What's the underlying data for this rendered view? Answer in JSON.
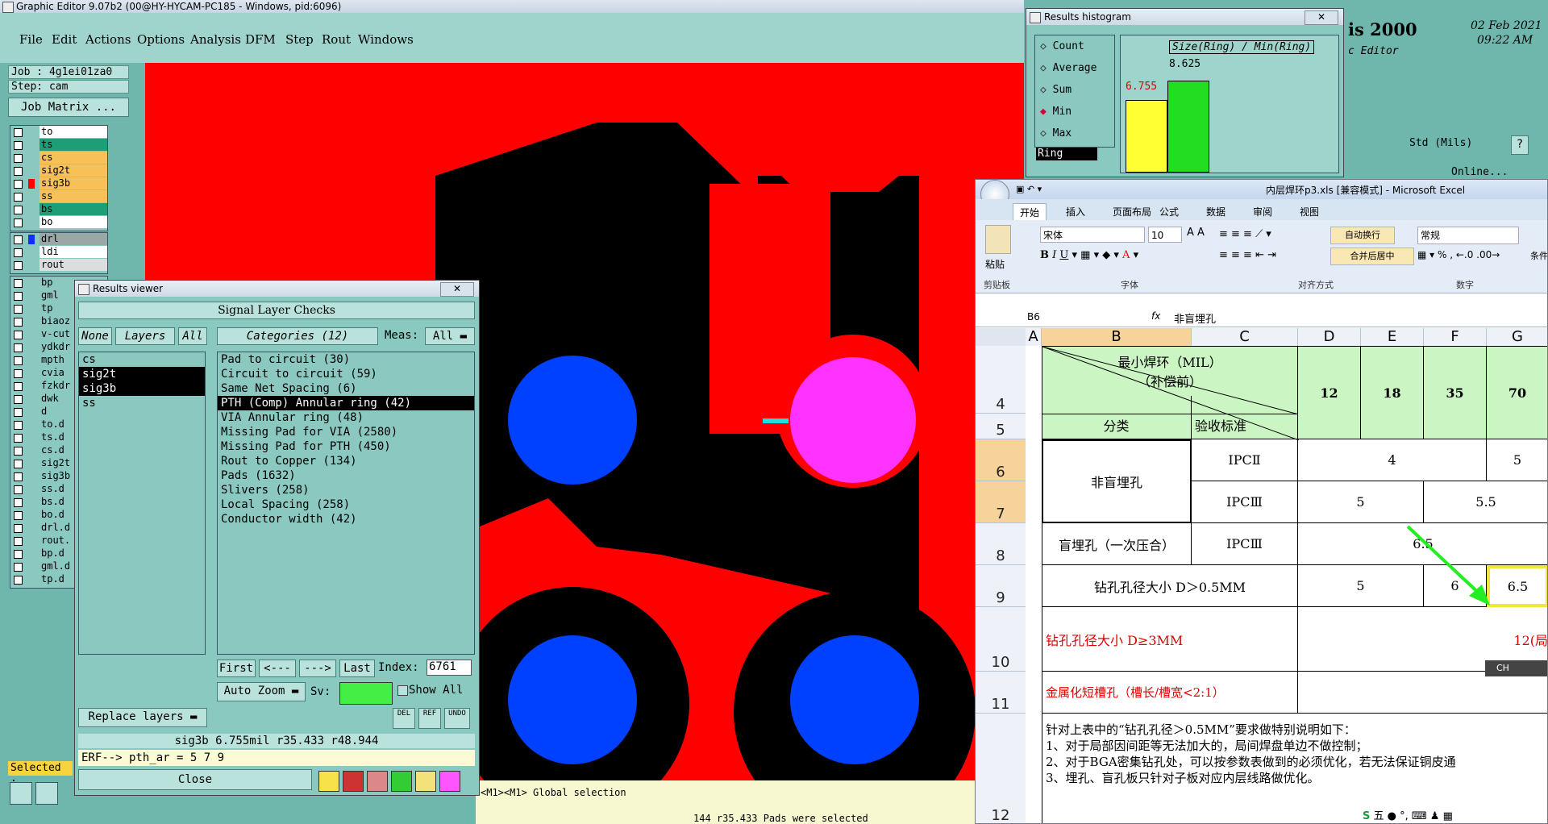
{
  "main_window": {
    "title": "Graphic Editor 9.07b2 (00@HY-HYCAM-PC185 - Windows, pid:6096)",
    "menu": [
      "File",
      "Edit",
      "Actions",
      "Options",
      "Analysis",
      "DFM",
      "Step",
      "Rout",
      "Windows"
    ],
    "job_label": "Job : 4g1ei01za0",
    "step_label": "Step: cam",
    "job_matrix_button": "Job Matrix ...",
    "selected_label": "Selected :",
    "status_line": "<M1><M1> Global selection",
    "status_bottom": "144 r35.433 Pads were selected"
  },
  "layers_group1": [
    {
      "name": "to",
      "color": "#ffffff"
    },
    {
      "name": "ts",
      "color": "#1e9e76"
    },
    {
      "name": "cs",
      "color": "#f7c15a"
    },
    {
      "name": "sig2t",
      "color": "#f7c15a"
    },
    {
      "name": "sig3b",
      "color": "#f7c15a",
      "swatch": "#ff0000"
    },
    {
      "name": "ss",
      "color": "#f7c15a"
    },
    {
      "name": "bs",
      "color": "#1e9e76"
    },
    {
      "name": "bo",
      "color": "#ffffff"
    }
  ],
  "layers_group2": [
    {
      "name": "drl",
      "color": "#9aa7a5",
      "swatch": "#1030ff"
    },
    {
      "name": "ldi",
      "color": "#ffffff"
    },
    {
      "name": "rout",
      "color": "#dddddd"
    }
  ],
  "layers_group3": [
    "bp",
    "gml",
    "tp",
    "biaoz",
    "v-cut",
    "ydkdr",
    "mpth",
    "cvia",
    "fzkdr",
    "dwk",
    "d",
    "to.d",
    "ts.d",
    "cs.d",
    "sig2t",
    "sig3b",
    "ss.d",
    "bs.d",
    "bo.d",
    "drl.d",
    "rout.",
    "bp.d",
    "gml.d",
    "tp.d"
  ],
  "results_viewer": {
    "title": "Results viewer",
    "close_x": "✕",
    "header": "Signal Layer Checks",
    "none_button": "None",
    "layers_button": "Layers",
    "all_button": "All",
    "categories_button": "Categories (12)",
    "meas_label": "Meas:",
    "meas_value": "All",
    "layer_list": [
      "cs",
      "sig2t",
      "sig3b",
      "ss"
    ],
    "selected_layers": [
      "sig2t",
      "sig3b"
    ],
    "categories": [
      "Pad to circuit (30)",
      "Circuit to circuit (59)",
      "Same Net Spacing (6)",
      "PTH (Comp) Annular ring (42)",
      "VIA Annular ring (48)",
      "Missing Pad for VIA (2580)",
      "Missing Pad for PTH (450)",
      "Rout to Copper (134)",
      "Pads (1632)",
      "Slivers (258)",
      "Local Spacing (258)",
      "Conductor width (42)"
    ],
    "selected_category": "PTH (Comp) Annular ring (42)",
    "first_button": "First",
    "prev_button": "<---",
    "next_button": "--->",
    "last_button": "Last",
    "index_label": "Index:",
    "index_value": "6761",
    "auto_zoom": "Auto Zoom",
    "sv_label": "Sv:",
    "show_all": "Show All",
    "replace_layers": "Replace layers",
    "tool_labels": [
      "DEL",
      "REF",
      "UNDO"
    ],
    "info_line": "sig3b 6.755mil  r35.433  r48.944",
    "erf_line": "ERF--> pth_ar = 5 7 9",
    "close_button": "Close"
  },
  "histogram": {
    "title": "Results histogram",
    "options": [
      "Count",
      "Average",
      "Sum",
      "Min",
      "Max"
    ],
    "selected_option": "Min",
    "field_value": "Ring",
    "chart_title": "Size(Ring) / Min(Ring)",
    "bars": [
      {
        "label": "6.755",
        "value": 6.755,
        "color": "#ffff33"
      },
      {
        "label": "8.625",
        "value": 8.625,
        "color": "#22dd22"
      }
    ],
    "right_title": "is 2000",
    "right_sub": "c Editor",
    "date": "02 Feb 2021",
    "time": "09:22 AM",
    "std_label": "Std (Mils)",
    "help_label": "?",
    "online_label": "Online..."
  },
  "excel": {
    "title": "内层焊环p3.xls  [兼容模式] - Microsoft Excel",
    "tabs": [
      "开始",
      "插入",
      "页面布局",
      "公式",
      "数据",
      "审阅",
      "视图"
    ],
    "active_tab": "开始",
    "paste_label": "粘贴",
    "font_name": "宋体",
    "font_size": "10",
    "wrap_text": "自动换行",
    "merge_center": "合并后居中",
    "number_format": "常规",
    "groups": [
      "剪贴板",
      "字体",
      "对齐方式",
      "数字"
    ],
    "cond_label": "条件",
    "name_box": "B6",
    "fx": "fx",
    "formula_value": "非盲埋孔",
    "columns": [
      "A",
      "B",
      "C",
      "D",
      "E",
      "F",
      "G"
    ],
    "rows": [
      "4",
      "5",
      "6",
      "7",
      "8",
      "9",
      "10",
      "11",
      "12"
    ],
    "header_cell": "最小焊环（MIL）\n（补偿前）",
    "col_values": [
      "12",
      "18",
      "35",
      "70"
    ],
    "category_label": "分类",
    "standard_label": "验收标准",
    "r6_label": "非盲埋孔",
    "r6_std": "IPCⅡ",
    "r6_val1": "4",
    "r6_val2": "5",
    "r7_std": "IPCⅢ",
    "r7_val1": "5",
    "r7_val2": "5.5",
    "r8_label": "盲埋孔（一次压合）",
    "r8_std": "IPCⅢ",
    "r8_val": "6.5",
    "r9_label": "钻孔孔径大小    D＞0.5MM",
    "r9_val1": "5",
    "r9_val2": "6",
    "r9_val3": "6.5",
    "r10_label": "钻孔孔径大小    D≥3MM",
    "r10_val": "12(局",
    "r11_label": "金属化短槽孔（槽长/槽宽<2:1）",
    "note_lines": [
      "针对上表中的“钻孔孔径＞0.5MM”要求做特别说明如下：",
      "1、对于局部因间距等无法加大的，局间焊盘单边不做控制；",
      "2、对于BGA密集钻孔处，可以按参数表做到的必须优化，若无法保证铜皮通",
      "3、埋孔、盲孔板只针对子板对应内层线路做优化。"
    ],
    "ime_label": "CH",
    "taskbar_ime": "五"
  }
}
